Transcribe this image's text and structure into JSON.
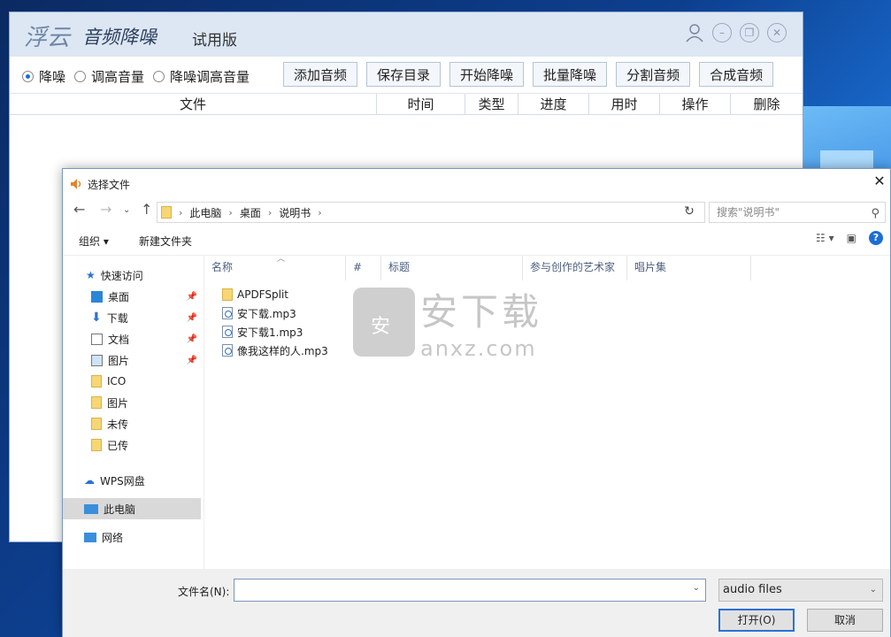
{
  "app": {
    "logo": "浮云",
    "name": "音频降噪",
    "edition": "试用版",
    "modes": [
      {
        "label": "降噪",
        "selected": true
      },
      {
        "label": "调高音量",
        "selected": false
      },
      {
        "label": "降噪调高音量",
        "selected": false
      }
    ],
    "buttons": [
      "添加音频",
      "保存目录",
      "开始降噪",
      "批量降噪",
      "分割音频",
      "合成音频"
    ],
    "columns": [
      "文件",
      "时间",
      "类型",
      "进度",
      "用时",
      "操作",
      "删除"
    ]
  },
  "dialog": {
    "title": "选择文件",
    "breadcrumb": [
      "此电脑",
      "桌面",
      "说明书"
    ],
    "search_placeholder": "搜索\"说明书\"",
    "organize": "组织",
    "new_folder": "新建文件夹",
    "sidebar": {
      "quick_access": "快速访问",
      "items": [
        "桌面",
        "下载",
        "文档",
        "图片",
        "ICO",
        "图片",
        "未传",
        "已传"
      ],
      "wps": "WPS网盘",
      "this_pc": "此电脑",
      "network": "网络"
    },
    "columns": [
      "名称",
      "#",
      "标题",
      "参与创作的艺术家",
      "唱片集"
    ],
    "files": [
      {
        "name": "APDFSplit",
        "kind": "folder"
      },
      {
        "name": "安下载.mp3",
        "kind": "mp3"
      },
      {
        "name": "安下载1.mp3",
        "kind": "mp3"
      },
      {
        "name": "像我这样的人.mp3",
        "kind": "mp3"
      }
    ],
    "filename_label": "文件名(N):",
    "filename_value": "",
    "filetype": "audio files",
    "open_label": "打开(O)",
    "cancel_label": "取消"
  },
  "watermark": {
    "cn": "安下载",
    "en": "anxz.com"
  }
}
